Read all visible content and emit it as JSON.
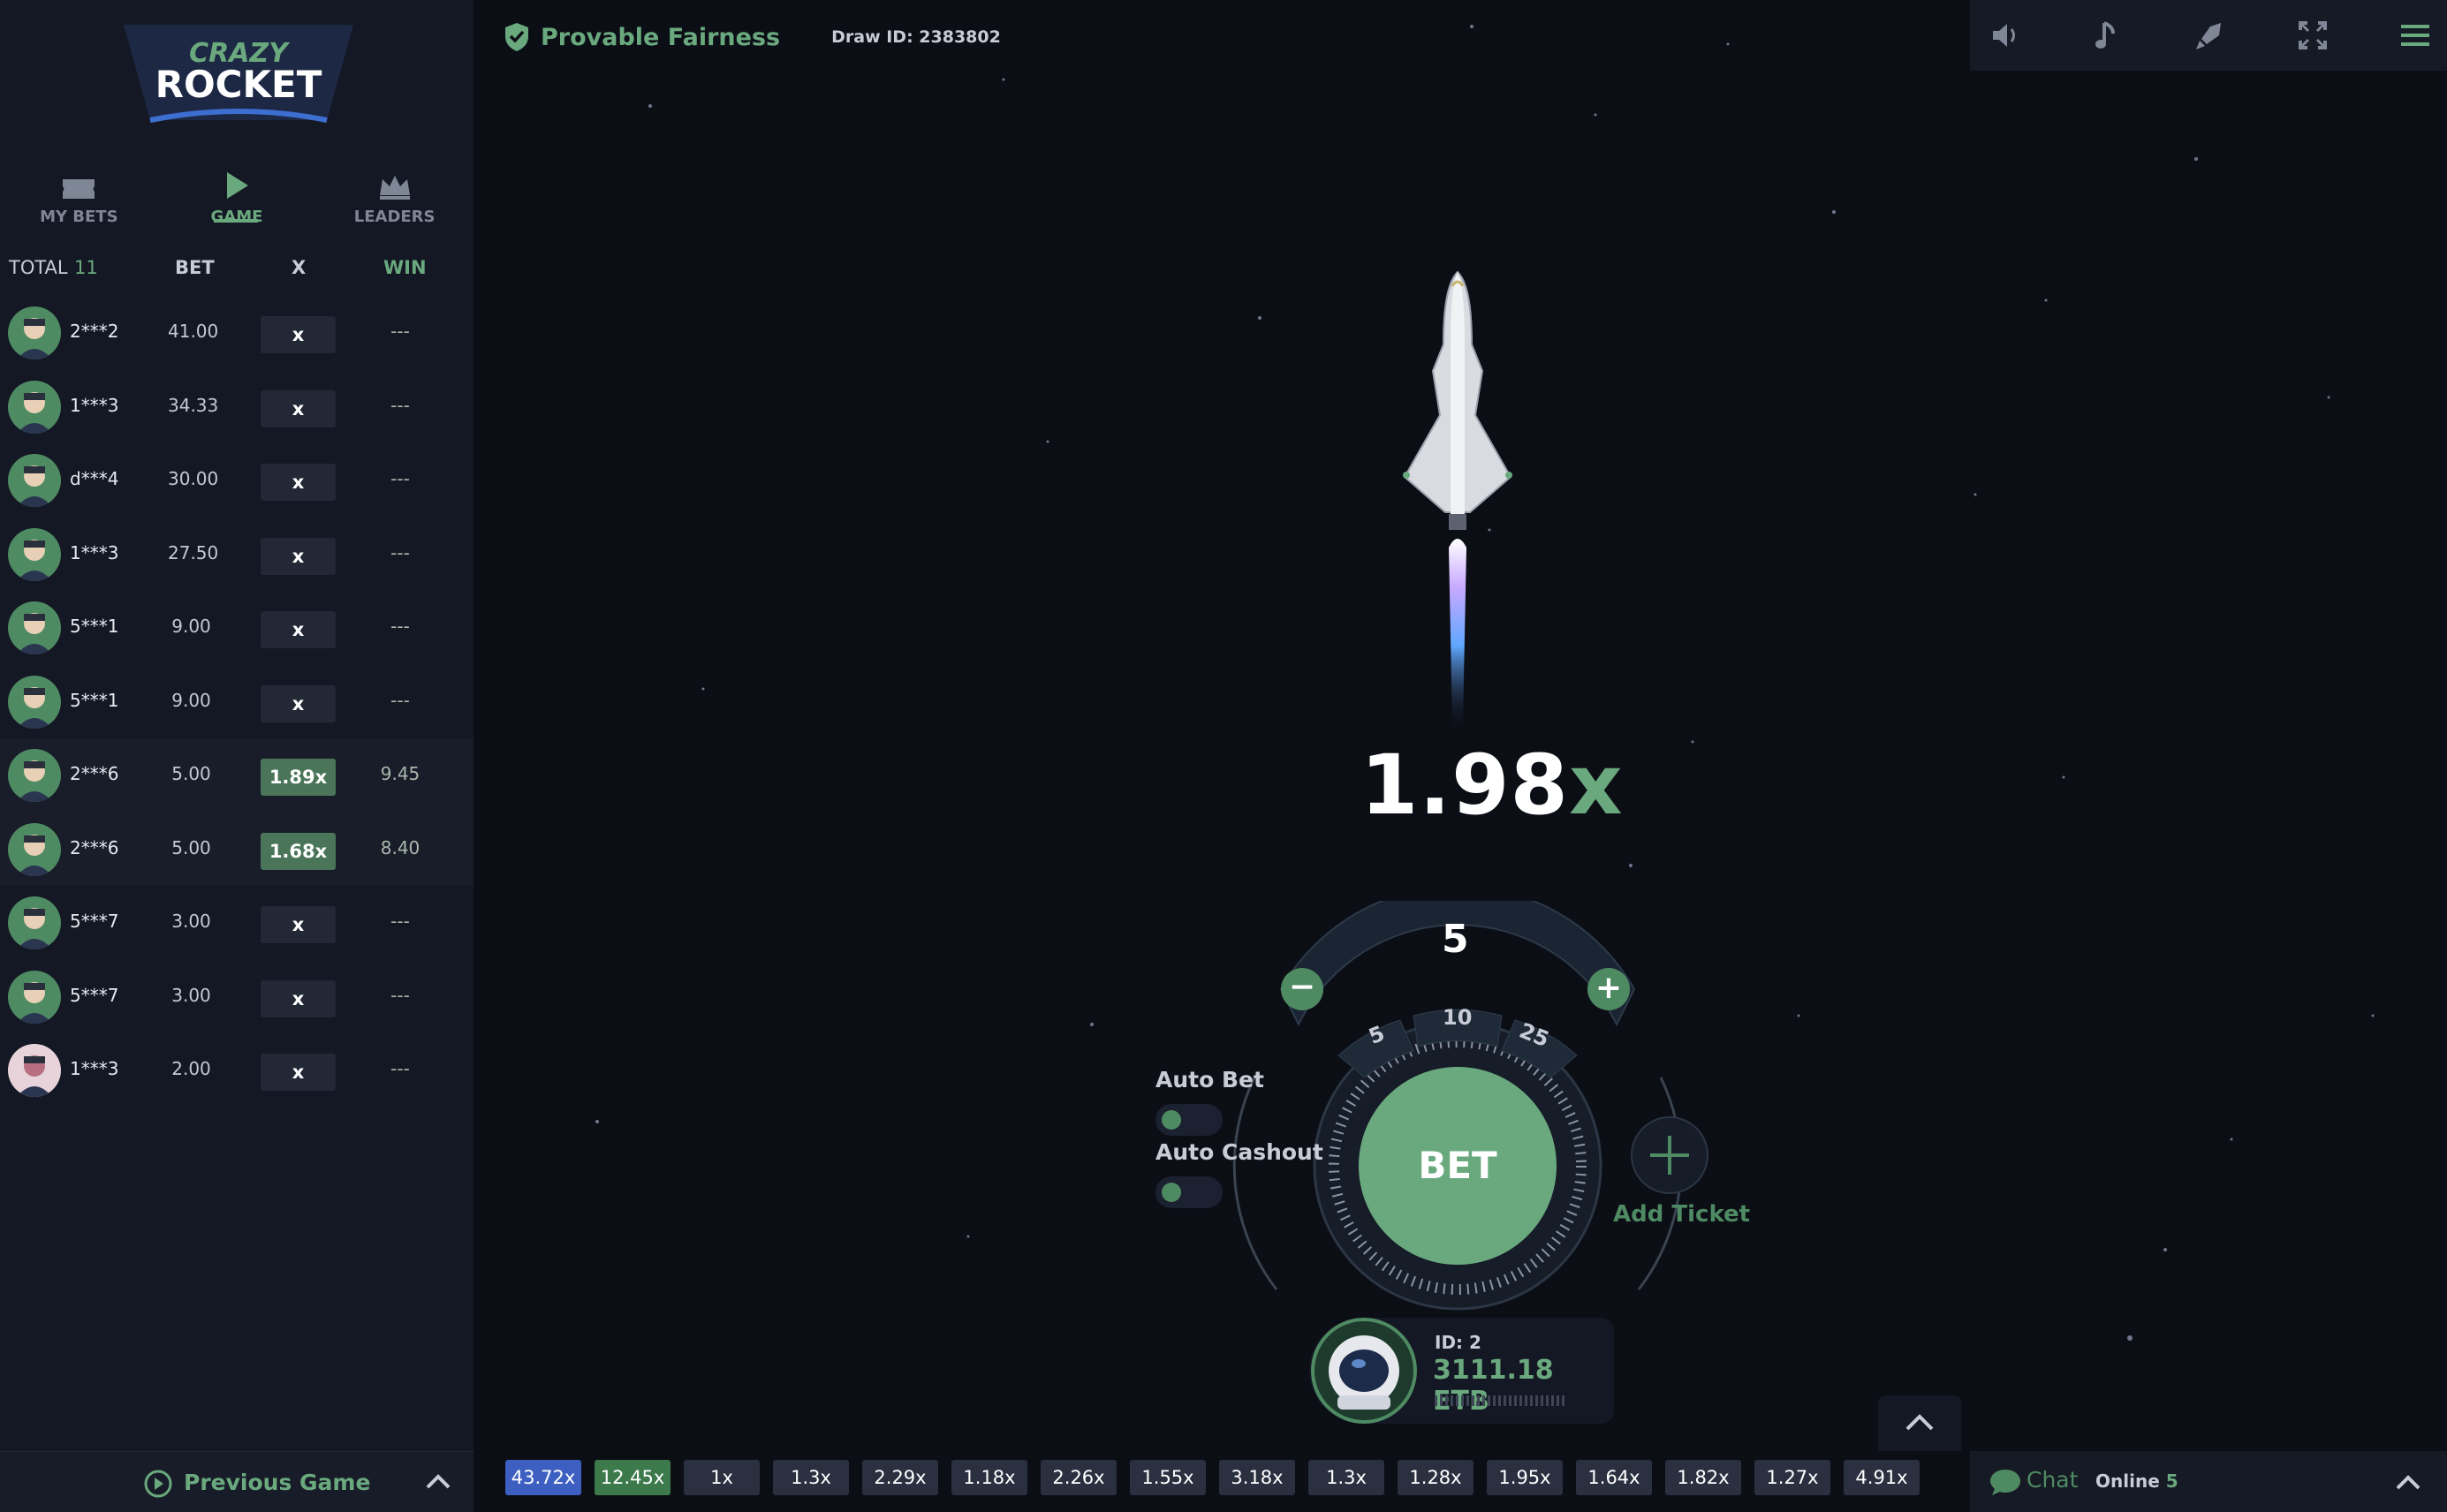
{
  "brand": {
    "line1": "CRAZY",
    "line2": "ROCKET"
  },
  "nav": {
    "items": [
      {
        "label": "MY BETS",
        "icon": "tickets-icon"
      },
      {
        "label": "GAME",
        "icon": "play-icon"
      },
      {
        "label": "LEADERS",
        "icon": "crown-icon"
      }
    ]
  },
  "bets_table": {
    "total_label": "TOTAL",
    "total_count": "11",
    "headers": {
      "bet": "BET",
      "x": "X",
      "win": "WIN"
    },
    "rows": [
      {
        "user": "2***2",
        "bet": "41.00",
        "x": "x",
        "win": "---"
      },
      {
        "user": "1***3",
        "bet": "34.33",
        "x": "x",
        "win": "---"
      },
      {
        "user": "d***4",
        "bet": "30.00",
        "x": "x",
        "win": "---"
      },
      {
        "user": "1***3",
        "bet": "27.50",
        "x": "x",
        "win": "---"
      },
      {
        "user": "5***1",
        "bet": "9.00",
        "x": "x",
        "win": "---"
      },
      {
        "user": "5***1",
        "bet": "9.00",
        "x": "x",
        "win": "---"
      },
      {
        "user": "2***6",
        "bet": "5.00",
        "x": "1.89x",
        "win": "9.45"
      },
      {
        "user": "2***6",
        "bet": "5.00",
        "x": "1.68x",
        "win": "8.40"
      },
      {
        "user": "5***7",
        "bet": "3.00",
        "x": "x",
        "win": "---"
      },
      {
        "user": "5***7",
        "bet": "3.00",
        "x": "x",
        "win": "---"
      },
      {
        "user": "1***3",
        "bet": "2.00",
        "x": "x",
        "win": "---"
      }
    ]
  },
  "previous_game": {
    "label": "Previous Game"
  },
  "header": {
    "fairness": "Provable Fairness",
    "draw_id": "Draw ID: 2383802"
  },
  "tools": [
    "sound-icon",
    "music-icon",
    "rocket-icon",
    "fullscreen-icon",
    "menu-icon"
  ],
  "game": {
    "multiplier_value": "1.98",
    "multiplier_suffix": "x"
  },
  "bet_panel": {
    "amount": "5",
    "quick_amounts": [
      "5",
      "10",
      "25"
    ],
    "bet_label": "BET",
    "auto_bet_label": "Auto Bet",
    "auto_cashout_label": "Auto Cashout",
    "add_ticket_label": "Add Ticket"
  },
  "account": {
    "id": "ID: 2",
    "balance": "3111.18 ETB"
  },
  "history": [
    "43.72x",
    "12.45x",
    "1x",
    "1.3x",
    "2.29x",
    "1.18x",
    "2.26x",
    "1.55x",
    "3.18x",
    "1.3x",
    "1.28x",
    "1.95x",
    "1.64x",
    "1.82x",
    "1.27x",
    "4.91x"
  ],
  "chat": {
    "label": "Chat",
    "online_label": "Online",
    "online_count": "5"
  },
  "colors": {
    "accent_green": "#6aa97e",
    "chip_blue": "#3d5fc2",
    "chip_green": "#3c7a4c",
    "panel": "#141824",
    "background": "#0c0e16"
  }
}
